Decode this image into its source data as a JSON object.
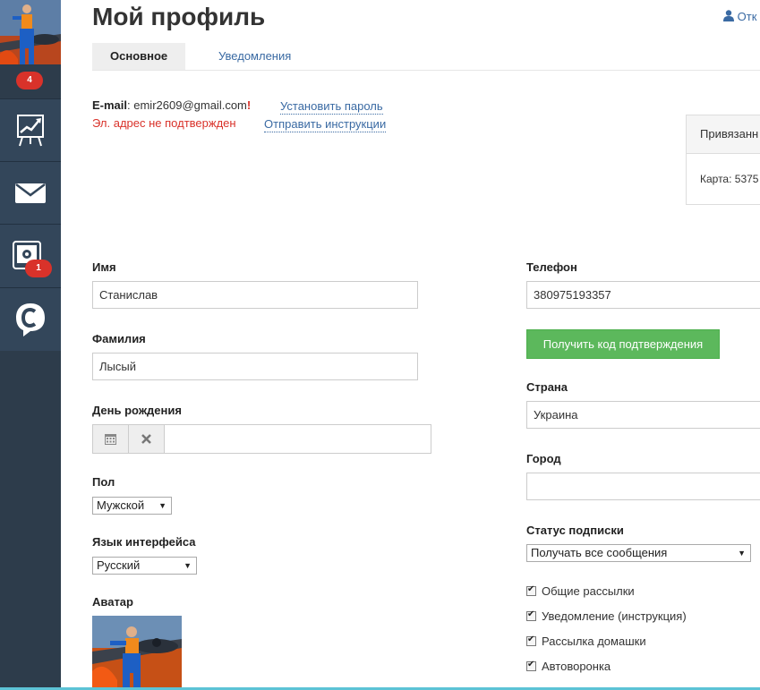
{
  "sidebar": {
    "avatar_badge": "4",
    "items": [
      {
        "name": "stats",
        "icon": "chart-board-icon"
      },
      {
        "name": "messages",
        "icon": "envelope-icon"
      },
      {
        "name": "settings",
        "icon": "gear-frame-icon",
        "badge": "1"
      },
      {
        "name": "brand",
        "icon": "chat-c-logo-icon"
      }
    ]
  },
  "header": {
    "title": "Мой профиль",
    "exit_link": "Отк"
  },
  "tabs": [
    {
      "label": "Основное",
      "active": true
    },
    {
      "label": "Уведомления",
      "active": false
    }
  ],
  "email": {
    "label": "E-mail",
    "value": "emir2609@gmail.com",
    "warn_mark": "!",
    "set_password_link": "Установить пароль",
    "not_confirmed": "Эл. адрес не подтвержден",
    "send_instructions_link": "Отправить инструкции"
  },
  "card_panel": {
    "header": "Привязанн",
    "body": "Карта: 5375"
  },
  "left_form": {
    "first_name": {
      "label": "Имя",
      "value": "Станислав"
    },
    "last_name": {
      "label": "Фамилия",
      "value": "Лысый"
    },
    "birthday": {
      "label": "День рождения",
      "value": ""
    },
    "gender": {
      "label": "Пол",
      "value": "Мужской"
    },
    "language": {
      "label": "Язык интерфейса",
      "value": "Русский"
    },
    "avatar": {
      "label": "Аватар"
    }
  },
  "right_form": {
    "phone": {
      "label": "Телефон",
      "value": "380975193357"
    },
    "get_code_button": "Получить код подтверждения",
    "country": {
      "label": "Страна",
      "value": "Украина"
    },
    "city": {
      "label": "Город",
      "value": ""
    },
    "subscription": {
      "label": "Статус подписки",
      "value": "Получать все сообщения"
    },
    "checkboxes": [
      {
        "label": "Общие рассылки",
        "checked": true
      },
      {
        "label": "Уведомление (инструкция)",
        "checked": true
      },
      {
        "label": "Рассылка домашки",
        "checked": true
      },
      {
        "label": "Автоворонка",
        "checked": true
      }
    ]
  },
  "colors": {
    "sidebar": "#2d3c4b",
    "link": "#3a6aa3",
    "error": "#d9322a",
    "success": "#5cb85c",
    "badge": "#d9322a"
  }
}
